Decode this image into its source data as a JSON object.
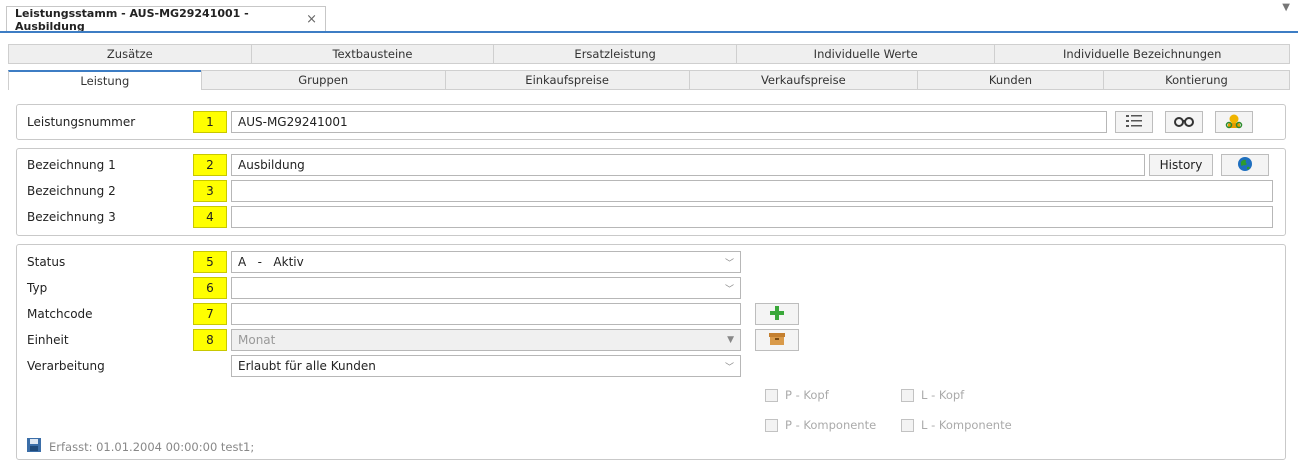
{
  "doc_tab": {
    "title": "Leistungsstamm - AUS-MG29241001 - Ausbildung",
    "close": "×"
  },
  "tabs_top": [
    "Zusätze",
    "Textbausteine",
    "Ersatzleistung",
    "Individuelle Werte",
    "Individuelle Bezeichnungen"
  ],
  "tabs_bottom": [
    "Leistung",
    "Gruppen",
    "Einkaufspreise",
    "Verkaufspreise",
    "Kunden",
    "Kontierung"
  ],
  "active_tab": "Leistung",
  "leistungsnummer": {
    "label": "Leistungsnummer",
    "num": "1",
    "value": "AUS-MG29241001"
  },
  "bezeichnung": [
    {
      "label": "Bezeichnung 1",
      "num": "2",
      "value": "Ausbildung"
    },
    {
      "label": "Bezeichnung 2",
      "num": "3",
      "value": ""
    },
    {
      "label": "Bezeichnung 3",
      "num": "4",
      "value": ""
    }
  ],
  "history_label": "History",
  "status": {
    "label": "Status",
    "num": "5",
    "value": "A   -   Aktiv"
  },
  "typ": {
    "label": "Typ",
    "num": "6",
    "value": ""
  },
  "matchcode": {
    "label": "Matchcode",
    "num": "7",
    "value": ""
  },
  "einheit": {
    "label": "Einheit",
    "num": "8",
    "value": "Monat"
  },
  "verarbeitung": {
    "label": "Verarbeitung",
    "value": "Erlaubt für alle Kunden"
  },
  "checkboxes": {
    "p_kopf": "P - Kopf",
    "l_kopf": "L - Kopf",
    "p_komponente": "P - Komponente",
    "l_komponente": "L - Komponente"
  },
  "footer_text": "Erfasst: 01.01.2004 00:00:00 test1;",
  "colors": {
    "accent": "#3d7dc4",
    "highlight": "#ffff00"
  }
}
